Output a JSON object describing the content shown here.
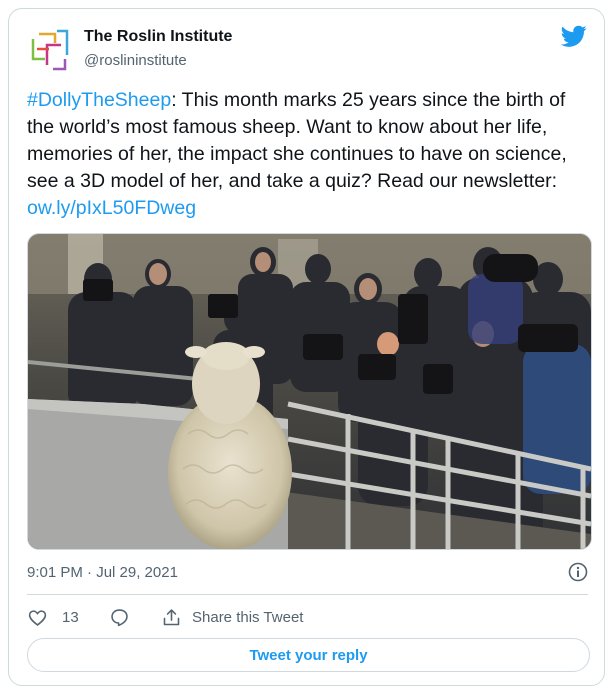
{
  "author": {
    "name": "The Roslin Institute",
    "handle": "@roslininstitute",
    "logo_icon": "roslin-institute-logo"
  },
  "brand_icon": "twitter-bird-icon",
  "tweet": {
    "hashtag": "#DollyTheSheep",
    "body": ": This month marks 25 years since the birth of the world’s most famous sheep. Want to know about her life, memories of her, the impact she continues to have on science, see a 3D model of her, and take a quiz? Read our newsletter: ",
    "link": "ow.ly/pIxL50FDweg"
  },
  "media": {
    "type": "photo",
    "icon": "photo-dolly-sheep-press"
  },
  "timestamp": "9:01 PM · Jul 29, 2021",
  "actions": {
    "like_count": "13",
    "share_label": "Share this Tweet",
    "reply_button": "Tweet your reply"
  },
  "colors": {
    "accent": "#1d9bf0",
    "text": "#0f1419",
    "secondary": "#536471",
    "border": "#cfd9de"
  }
}
